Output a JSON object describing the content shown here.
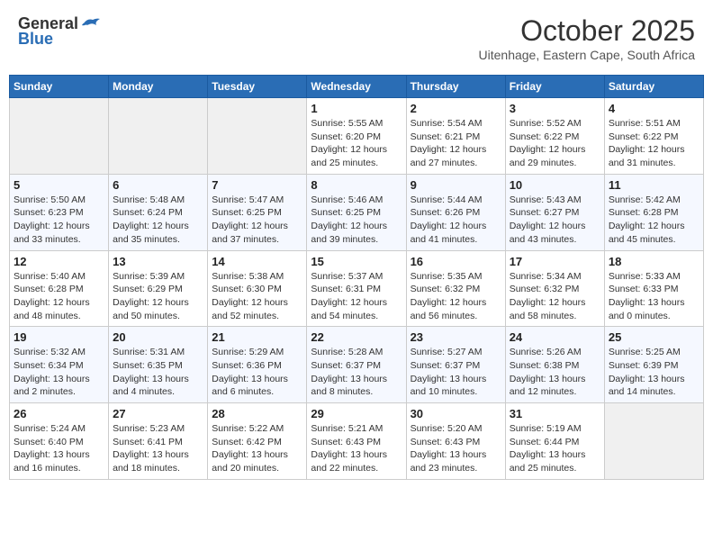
{
  "header": {
    "logo_general": "General",
    "logo_blue": "Blue",
    "month_title": "October 2025",
    "location": "Uitenhage, Eastern Cape, South Africa"
  },
  "days_of_week": [
    "Sunday",
    "Monday",
    "Tuesday",
    "Wednesday",
    "Thursday",
    "Friday",
    "Saturday"
  ],
  "weeks": [
    {
      "days": [
        {
          "num": "",
          "detail": ""
        },
        {
          "num": "",
          "detail": ""
        },
        {
          "num": "",
          "detail": ""
        },
        {
          "num": "1",
          "detail": "Sunrise: 5:55 AM\nSunset: 6:20 PM\nDaylight: 12 hours\nand 25 minutes."
        },
        {
          "num": "2",
          "detail": "Sunrise: 5:54 AM\nSunset: 6:21 PM\nDaylight: 12 hours\nand 27 minutes."
        },
        {
          "num": "3",
          "detail": "Sunrise: 5:52 AM\nSunset: 6:22 PM\nDaylight: 12 hours\nand 29 minutes."
        },
        {
          "num": "4",
          "detail": "Sunrise: 5:51 AM\nSunset: 6:22 PM\nDaylight: 12 hours\nand 31 minutes."
        }
      ]
    },
    {
      "days": [
        {
          "num": "5",
          "detail": "Sunrise: 5:50 AM\nSunset: 6:23 PM\nDaylight: 12 hours\nand 33 minutes."
        },
        {
          "num": "6",
          "detail": "Sunrise: 5:48 AM\nSunset: 6:24 PM\nDaylight: 12 hours\nand 35 minutes."
        },
        {
          "num": "7",
          "detail": "Sunrise: 5:47 AM\nSunset: 6:25 PM\nDaylight: 12 hours\nand 37 minutes."
        },
        {
          "num": "8",
          "detail": "Sunrise: 5:46 AM\nSunset: 6:25 PM\nDaylight: 12 hours\nand 39 minutes."
        },
        {
          "num": "9",
          "detail": "Sunrise: 5:44 AM\nSunset: 6:26 PM\nDaylight: 12 hours\nand 41 minutes."
        },
        {
          "num": "10",
          "detail": "Sunrise: 5:43 AM\nSunset: 6:27 PM\nDaylight: 12 hours\nand 43 minutes."
        },
        {
          "num": "11",
          "detail": "Sunrise: 5:42 AM\nSunset: 6:28 PM\nDaylight: 12 hours\nand 45 minutes."
        }
      ]
    },
    {
      "days": [
        {
          "num": "12",
          "detail": "Sunrise: 5:40 AM\nSunset: 6:28 PM\nDaylight: 12 hours\nand 48 minutes."
        },
        {
          "num": "13",
          "detail": "Sunrise: 5:39 AM\nSunset: 6:29 PM\nDaylight: 12 hours\nand 50 minutes."
        },
        {
          "num": "14",
          "detail": "Sunrise: 5:38 AM\nSunset: 6:30 PM\nDaylight: 12 hours\nand 52 minutes."
        },
        {
          "num": "15",
          "detail": "Sunrise: 5:37 AM\nSunset: 6:31 PM\nDaylight: 12 hours\nand 54 minutes."
        },
        {
          "num": "16",
          "detail": "Sunrise: 5:35 AM\nSunset: 6:32 PM\nDaylight: 12 hours\nand 56 minutes."
        },
        {
          "num": "17",
          "detail": "Sunrise: 5:34 AM\nSunset: 6:32 PM\nDaylight: 12 hours\nand 58 minutes."
        },
        {
          "num": "18",
          "detail": "Sunrise: 5:33 AM\nSunset: 6:33 PM\nDaylight: 13 hours\nand 0 minutes."
        }
      ]
    },
    {
      "days": [
        {
          "num": "19",
          "detail": "Sunrise: 5:32 AM\nSunset: 6:34 PM\nDaylight: 13 hours\nand 2 minutes."
        },
        {
          "num": "20",
          "detail": "Sunrise: 5:31 AM\nSunset: 6:35 PM\nDaylight: 13 hours\nand 4 minutes."
        },
        {
          "num": "21",
          "detail": "Sunrise: 5:29 AM\nSunset: 6:36 PM\nDaylight: 13 hours\nand 6 minutes."
        },
        {
          "num": "22",
          "detail": "Sunrise: 5:28 AM\nSunset: 6:37 PM\nDaylight: 13 hours\nand 8 minutes."
        },
        {
          "num": "23",
          "detail": "Sunrise: 5:27 AM\nSunset: 6:37 PM\nDaylight: 13 hours\nand 10 minutes."
        },
        {
          "num": "24",
          "detail": "Sunrise: 5:26 AM\nSunset: 6:38 PM\nDaylight: 13 hours\nand 12 minutes."
        },
        {
          "num": "25",
          "detail": "Sunrise: 5:25 AM\nSunset: 6:39 PM\nDaylight: 13 hours\nand 14 minutes."
        }
      ]
    },
    {
      "days": [
        {
          "num": "26",
          "detail": "Sunrise: 5:24 AM\nSunset: 6:40 PM\nDaylight: 13 hours\nand 16 minutes."
        },
        {
          "num": "27",
          "detail": "Sunrise: 5:23 AM\nSunset: 6:41 PM\nDaylight: 13 hours\nand 18 minutes."
        },
        {
          "num": "28",
          "detail": "Sunrise: 5:22 AM\nSunset: 6:42 PM\nDaylight: 13 hours\nand 20 minutes."
        },
        {
          "num": "29",
          "detail": "Sunrise: 5:21 AM\nSunset: 6:43 PM\nDaylight: 13 hours\nand 22 minutes."
        },
        {
          "num": "30",
          "detail": "Sunrise: 5:20 AM\nSunset: 6:43 PM\nDaylight: 13 hours\nand 23 minutes."
        },
        {
          "num": "31",
          "detail": "Sunrise: 5:19 AM\nSunset: 6:44 PM\nDaylight: 13 hours\nand 25 minutes."
        },
        {
          "num": "",
          "detail": ""
        }
      ]
    }
  ]
}
